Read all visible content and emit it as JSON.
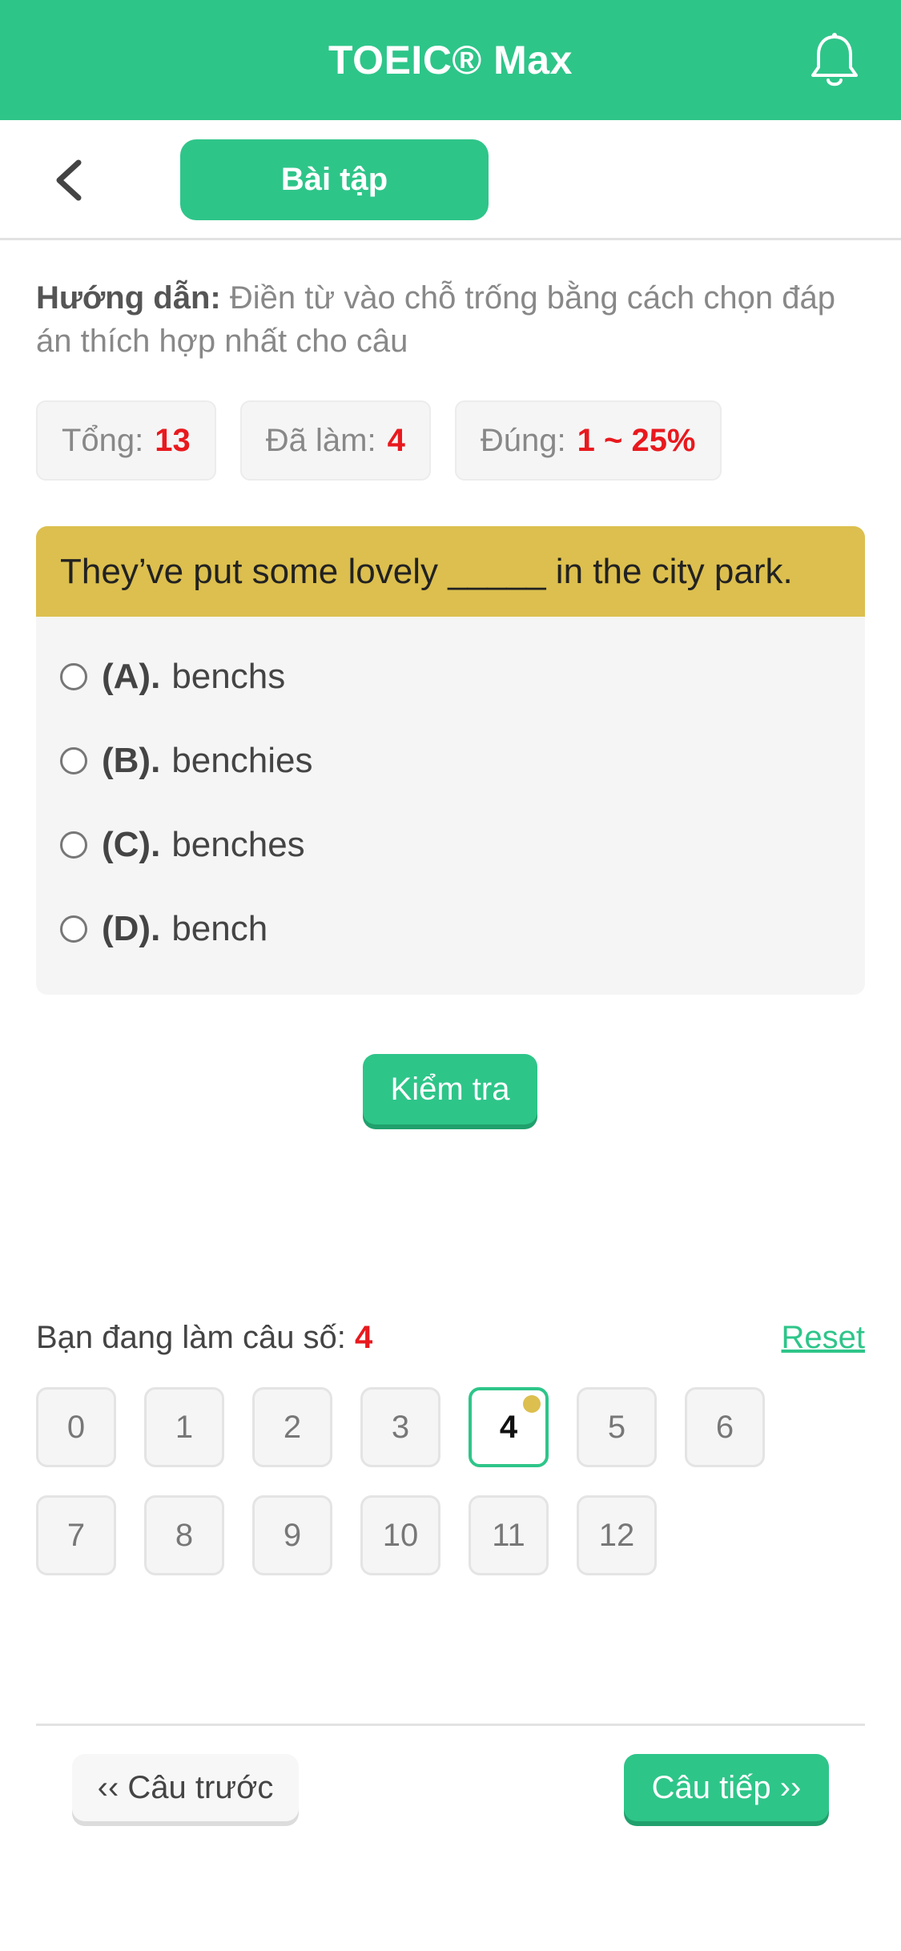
{
  "header": {
    "title": "TOEIC® Max"
  },
  "subbar": {
    "tab_label": "Bài tập"
  },
  "instructions": {
    "label": "Hướng dẫn:",
    "text": "Điền từ vào chỗ trống bằng cách chọn đáp án thích hợp nhất cho câu"
  },
  "stats": {
    "total_label": "Tổng:",
    "total_value": "13",
    "done_label": "Đã làm:",
    "done_value": "4",
    "correct_label": "Đúng:",
    "correct_value": "1 ~ 25%"
  },
  "question": {
    "text": "They’ve put some lovely _____ in the city park.",
    "options": [
      {
        "key": "(A).",
        "text": "benchs"
      },
      {
        "key": "(B).",
        "text": "benchies"
      },
      {
        "key": "(C).",
        "text": "benches"
      },
      {
        "key": "(D).",
        "text": "bench"
      }
    ]
  },
  "check_button": "Kiểm tra",
  "progress": {
    "label": "Bạn đang làm câu số:",
    "current": "4",
    "reset": "Reset",
    "numbers": [
      "0",
      "1",
      "2",
      "3",
      "4",
      "5",
      "6",
      "7",
      "8",
      "9",
      "10",
      "11",
      "12"
    ]
  },
  "nav": {
    "prev": "‹‹ Câu trước",
    "next": "Câu tiếp ››"
  },
  "colors": {
    "brand": "#2ec589",
    "question_bg": "#dcbf4e",
    "highlight": "#e8191e"
  }
}
